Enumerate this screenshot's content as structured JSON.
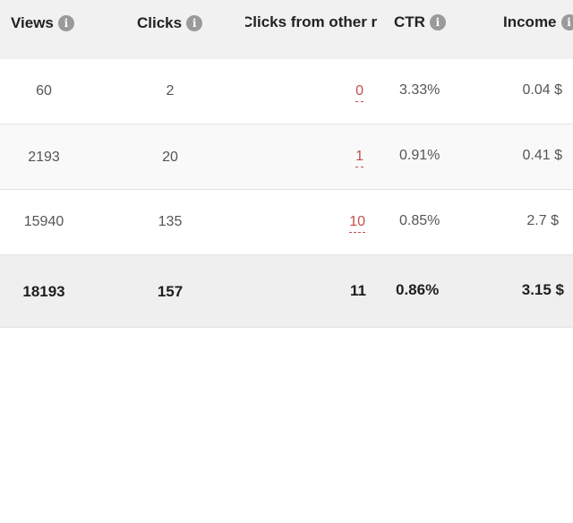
{
  "header": {
    "views": "Views",
    "clicks": "Clicks",
    "clicks_other": "Clicks from other r",
    "ctr": "CTR",
    "income": "Income",
    "info_glyph": "i"
  },
  "rows": [
    {
      "views": "60",
      "clicks": "2",
      "clicks_other": "0",
      "ctr": "3.33%",
      "income": "0.04 $"
    },
    {
      "views": "2193",
      "clicks": "20",
      "clicks_other": "1",
      "ctr": "0.91%",
      "income": "0.41 $"
    },
    {
      "views": "15940",
      "clicks": "135",
      "clicks_other": "10",
      "ctr": "0.85%",
      "income": "2.7 $"
    }
  ],
  "total": {
    "views": "18193",
    "clicks": "157",
    "clicks_other": "11",
    "ctr": "0.86%",
    "income": "3.15 $"
  },
  "colors": {
    "header_bg": "#f1f1f1",
    "link": "#c0504d",
    "total_bg": "#efefef"
  },
  "icons": [
    "info-icon"
  ]
}
